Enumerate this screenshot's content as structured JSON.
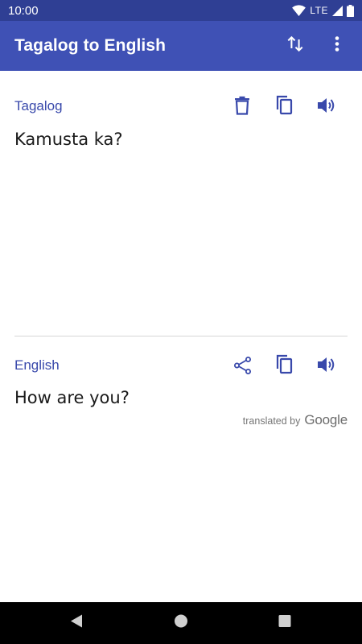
{
  "status_bar": {
    "time": "10:00",
    "network": "LTE",
    "icons": [
      "wifi-icon",
      "signal-icon",
      "battery-icon"
    ]
  },
  "app_bar": {
    "title": "Tagalog to English",
    "actions": [
      "swap-languages-icon",
      "more-vert-icon"
    ]
  },
  "source": {
    "language": "Tagalog",
    "text": "Kamusta ka?",
    "tools": [
      "delete-icon",
      "copy-icon",
      "speaker-icon"
    ]
  },
  "target": {
    "language": "English",
    "text": "How are you?",
    "tools": [
      "share-icon",
      "copy-icon",
      "speaker-icon"
    ],
    "attribution": {
      "prefix": "translated by",
      "brand": "Google"
    }
  },
  "colors": {
    "status_bar": "#2f3f94",
    "app_bar": "#3f51b5",
    "accent": "#3949ab",
    "nav_bar": "#000000"
  },
  "nav_bar": {
    "buttons": [
      "back-icon",
      "home-icon",
      "recents-icon"
    ]
  }
}
